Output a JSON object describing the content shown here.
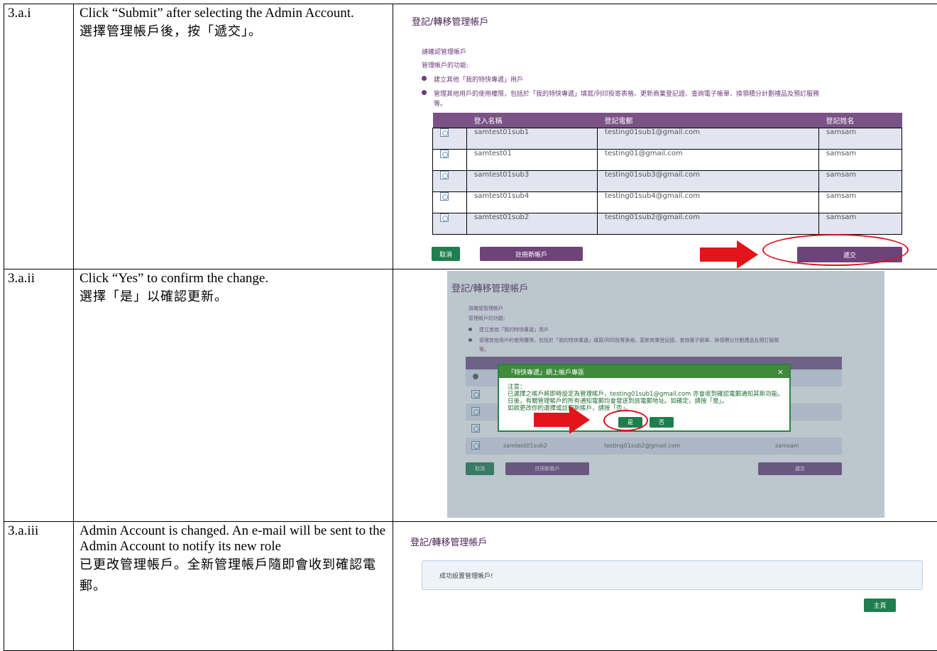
{
  "steps": [
    {
      "id": "3.a.i",
      "text_en": "Click “Submit” after selecting the Admin Account.",
      "text_zh": "選擇管理帳戶後，按「遞交」。"
    },
    {
      "id": "3.a.ii",
      "text_en": "Click “Yes” to confirm the change.",
      "text_zh": "選擇「是」以確認更新。"
    },
    {
      "id": "3.a.iii",
      "text_en": "Admin Account is changed. An e-mail will be sent to the Admin Account to notify its new role",
      "text_zh": "已更改管理帳戶。全新管理帳戶隨即會收到確認電郵。"
    }
  ],
  "shot1": {
    "title": "登記/轉移管理帳戶",
    "confirm_label": "請確認管理帳戶",
    "functions_label": "管理帳戶的功能:",
    "bullet1": "建立其他「我的特快專遞」用戶",
    "bullet2": "管理其他用戶的使用權限，包括於「我的特快專遞」填寫/列印投寄表格、更新商業登記證、查詢電子帳單、換領積分計劃禮品及預訂服務",
    "bullet2_cont": "等。",
    "columns": [
      "登入名稱",
      "登記電郵",
      "登記姓名"
    ],
    "rows": [
      [
        "samtest01sub1",
        "testing01sub1@gmail.com",
        "samsam"
      ],
      [
        "samtest01",
        "testing01@gmail.com",
        "samsam"
      ],
      [
        "samtest01sub3",
        "testing01sub3@gmail.com",
        "samsam"
      ],
      [
        "samtest01sub4",
        "testing01sub4@gmail.com",
        "samsam"
      ],
      [
        "samtest01sub2",
        "testing01sub2@gmail.com",
        "samsam"
      ]
    ],
    "cancel": "取消",
    "register_new": "註冊新帳戶",
    "submit": "遞交"
  },
  "shot2": {
    "title": "登記/轉移管理帳戶",
    "modal_title": "「特快專遞」網上帳戶專區",
    "modal_close": "×",
    "note_heading": "注意：",
    "note_line1": "已選擇之帳戶將即時設定為管理帳戶，testing01sub1@gmail.com 亦會收到確認電郵通知其新功能。",
    "note_line2": "日後，有關管理帳戶的所有通知電郵均會發送到該電郵地址。如確定，請按「是」。",
    "note_line3": "如欲更改你的選擇或註冊新帳戶，請按「否」。",
    "yes": "是",
    "no": "否",
    "visible_row": [
      "samtest01sub2",
      "testing01sub2@gmail.com",
      "samsam"
    ]
  },
  "shot3": {
    "title": "登記/轉移管理帳戶",
    "success_message": "成功設置管理帳戶!",
    "home": "主頁"
  },
  "colors": {
    "purple_header": "#7a5285",
    "purple_button": "#6e4379",
    "green_button": "#1e7e4d",
    "highlight_red": "#d9131d",
    "row_stripe": "#e2e5ef"
  }
}
